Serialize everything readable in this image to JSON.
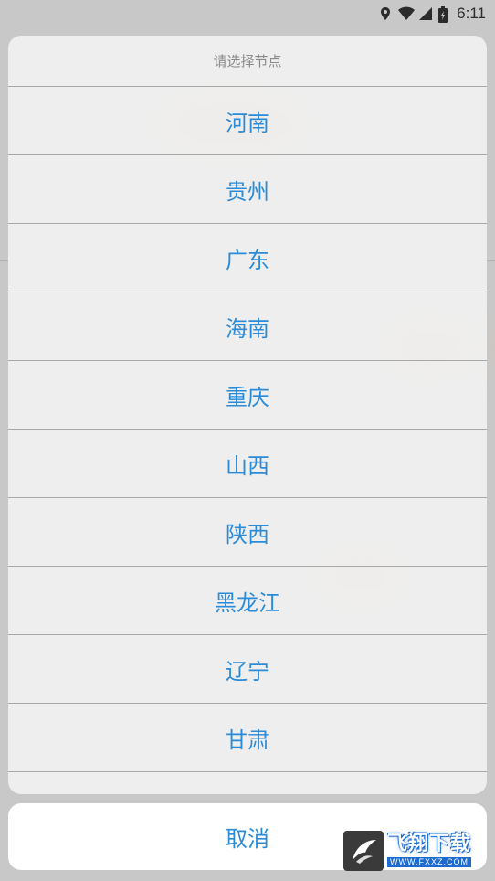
{
  "status_bar": {
    "time": "6:11",
    "icons": [
      "location-icon",
      "wifi-icon",
      "signal-icon",
      "battery-icon"
    ]
  },
  "sheet": {
    "title": "请选择节点",
    "options": [
      {
        "label": "河南"
      },
      {
        "label": "贵州"
      },
      {
        "label": "广东"
      },
      {
        "label": "海南"
      },
      {
        "label": "重庆"
      },
      {
        "label": "山西"
      },
      {
        "label": "陕西"
      },
      {
        "label": "黑龙江"
      },
      {
        "label": "辽宁"
      },
      {
        "label": "甘肃"
      }
    ],
    "cancel_label": "取消"
  },
  "watermark": {
    "main": "飞翔下载",
    "sub": "WWW.FXXZ.COM"
  },
  "colors": {
    "accent": "#2a8bd8",
    "title_gray": "#8a8a8a",
    "divider": "#a8a8a8"
  }
}
